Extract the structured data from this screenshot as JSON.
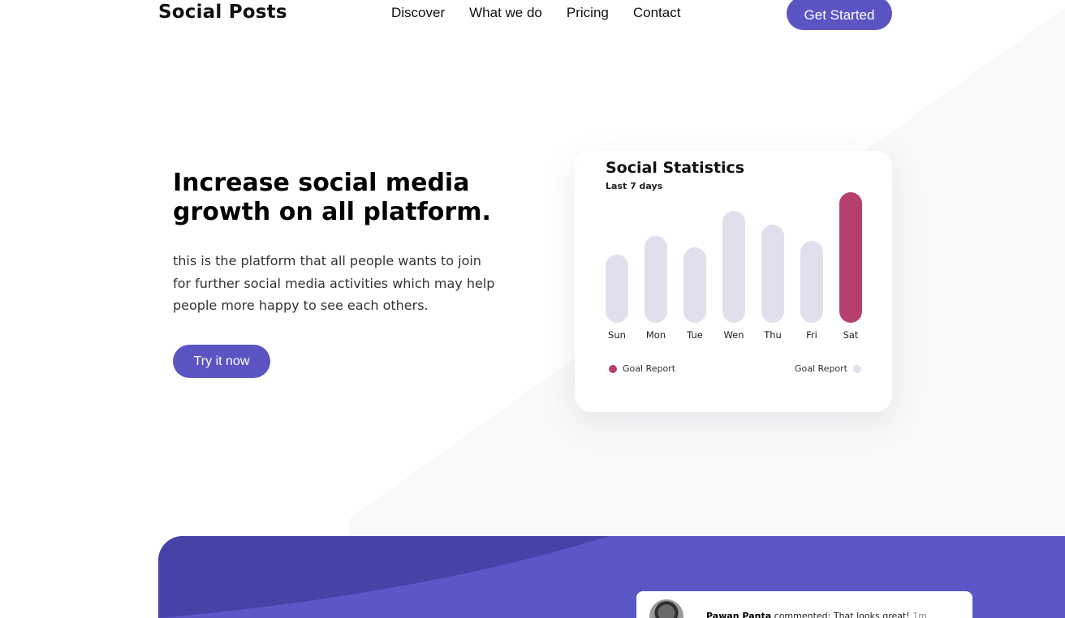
{
  "header": {
    "logo": "Social Posts",
    "nav": [
      "Discover",
      "What we do",
      "Pricing",
      "Contact"
    ],
    "cta": "Get Started"
  },
  "hero": {
    "title": "Increase social media growth on all platform.",
    "text": "this is the platform that all people wants to join for further social media activities which may help people more happy to see each others.",
    "button": "Try it now"
  },
  "stats_card": {
    "title": "Social Statistics",
    "subtitle": "Last 7 days",
    "legend_left": "Goal Report",
    "legend_right": "Goal Report"
  },
  "chart_data": {
    "type": "bar",
    "categories": [
      "Sun",
      "Mon",
      "Tue",
      "Wen",
      "Thu",
      "Fri",
      "Sat"
    ],
    "values": [
      85,
      108,
      94,
      140,
      122,
      102,
      163
    ],
    "highlight_index": 6,
    "colors": {
      "default": "#dfe0ec",
      "highlight": "#b5406e"
    },
    "ylim": [
      0,
      170
    ]
  },
  "comment": {
    "author": "Pawan Panta",
    "action": "commented:",
    "text": "That looks great!",
    "time": "1m"
  },
  "colors": {
    "accent": "#5b55c4",
    "accent_dark": "#4742a8",
    "highlight": "#b5406e",
    "bar": "#dfe0ec"
  }
}
